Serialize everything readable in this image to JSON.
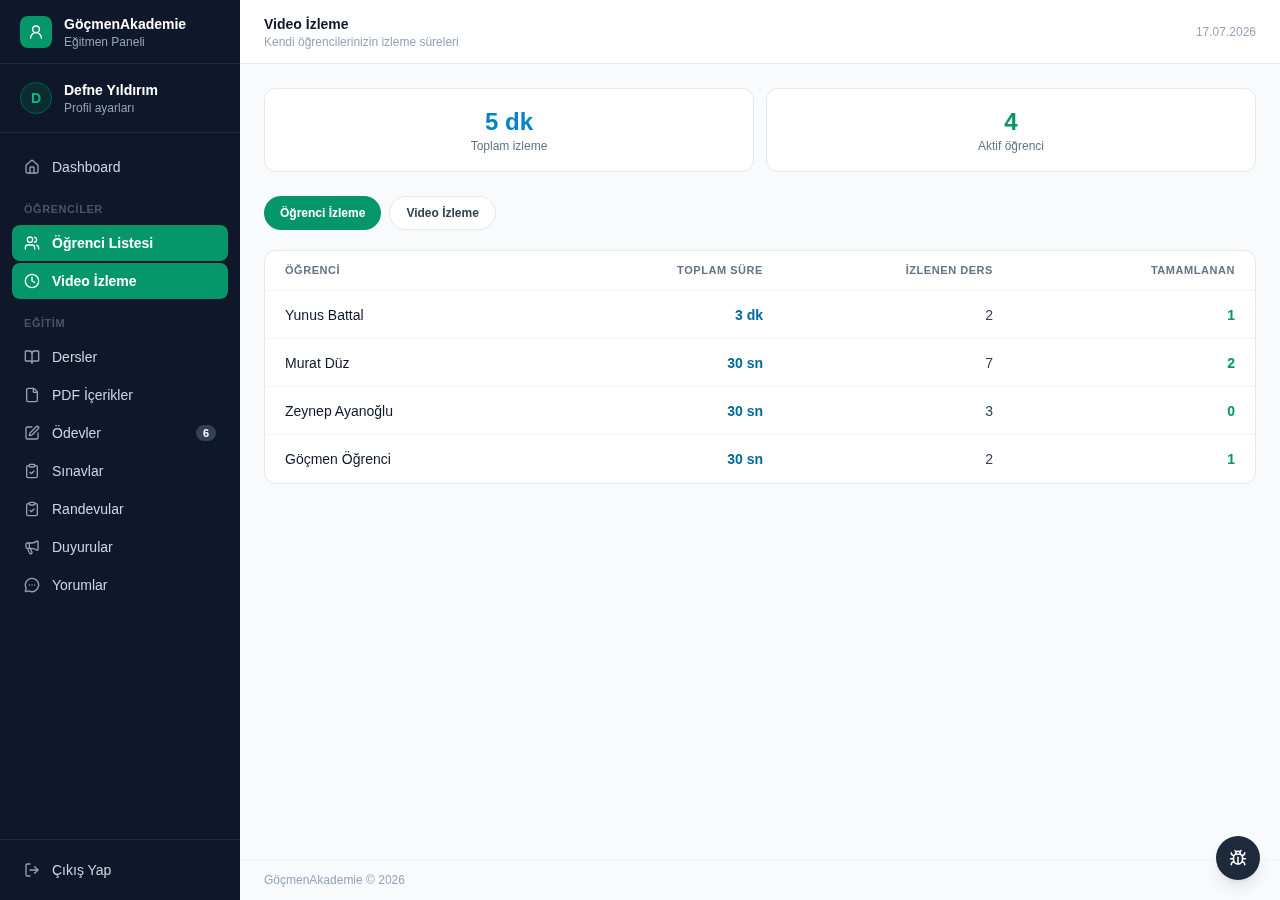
{
  "sidebar": {
    "brand": {
      "name": "GöçmenAkademie",
      "subtitle": "Eğitmen Paneli"
    },
    "user": {
      "initial": "D",
      "name": "Defne Yıldırım",
      "link": "Profil ayarları"
    },
    "nav": [
      {
        "items": [
          {
            "label": "Dashboard",
            "selected": false
          }
        ]
      },
      {
        "heading": "ÖĞRENCİLER",
        "items": [
          {
            "label": "Öğrenci Listesi",
            "selected": true
          },
          {
            "label": "Video İzleme",
            "selected": true
          }
        ]
      },
      {
        "heading": "EĞİTİM",
        "items": [
          {
            "label": "Dersler",
            "selected": false
          },
          {
            "label": "PDF İçerikler",
            "selected": false
          },
          {
            "label": "Ödevler",
            "selected": false,
            "badge": "6"
          },
          {
            "label": "Sınavlar",
            "selected": false
          },
          {
            "label": "Randevular",
            "selected": false
          },
          {
            "label": "Duyurular",
            "selected": false
          },
          {
            "label": "Yorumlar",
            "selected": false
          }
        ]
      }
    ],
    "logout": "Çıkış Yap"
  },
  "header": {
    "title": "Video İzleme",
    "subtitle": "Kendi öğrencilerinizin izleme süreleri",
    "date": "17.07.2026"
  },
  "stats": [
    {
      "value": "5 dk",
      "label": "Toplam izleme",
      "color": "#0284c7"
    },
    {
      "value": "4",
      "label": "Aktif öğrenci",
      "color": "#059669"
    }
  ],
  "tabs": [
    {
      "label": "Öğrenci İzleme",
      "selected": true
    },
    {
      "label": "Video İzleme",
      "selected": false
    }
  ],
  "table": {
    "columns": [
      "ÖĞRENCİ",
      "TOPLAM SÜRE",
      "İZLENEN DERS",
      "TAMAMLANAN"
    ],
    "rows": [
      [
        "Yunus Battal",
        "3 dk",
        "2",
        "1"
      ],
      [
        "Murat Düz",
        "30 sn",
        "7",
        "2"
      ],
      [
        "Zeynep Ayanoğlu",
        "30 sn",
        "3",
        "0"
      ],
      [
        "Göçmen Öğrenci",
        "30 sn",
        "2",
        "1"
      ]
    ]
  },
  "footer": "GöçmenAkademie © 2026"
}
